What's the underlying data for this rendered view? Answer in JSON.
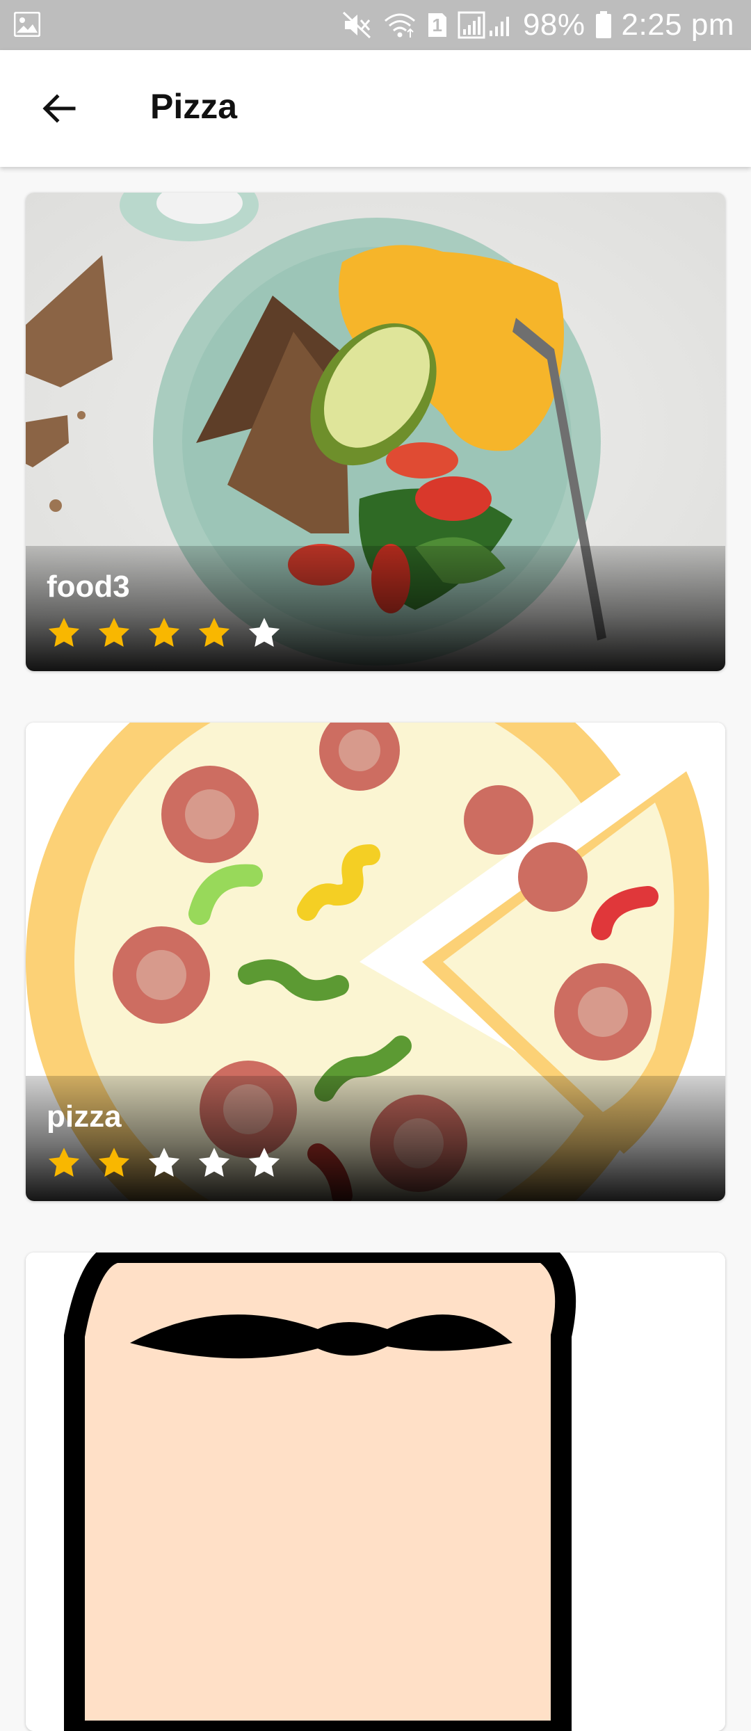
{
  "status_bar": {
    "battery": "98%",
    "time": "2:25 pm",
    "sim_slot": "1",
    "icons": [
      "image-icon",
      "mute-icon",
      "wifi-icon",
      "sim-icon",
      "signal-icon",
      "battery-icon"
    ]
  },
  "app_bar": {
    "title": "Pizza",
    "back_icon": "arrow-back-icon"
  },
  "cards": [
    {
      "title": "food3",
      "rating": 4,
      "max_rating": 5
    },
    {
      "title": "pizza",
      "rating": 2,
      "max_rating": 5
    },
    {
      "title": "",
      "rating": null,
      "max_rating": 5
    }
  ],
  "colors": {
    "star_on": "#f9b700",
    "star_off": "#ffffff",
    "status_bar": "#bdbdbd",
    "background": "#f8f8f8"
  }
}
